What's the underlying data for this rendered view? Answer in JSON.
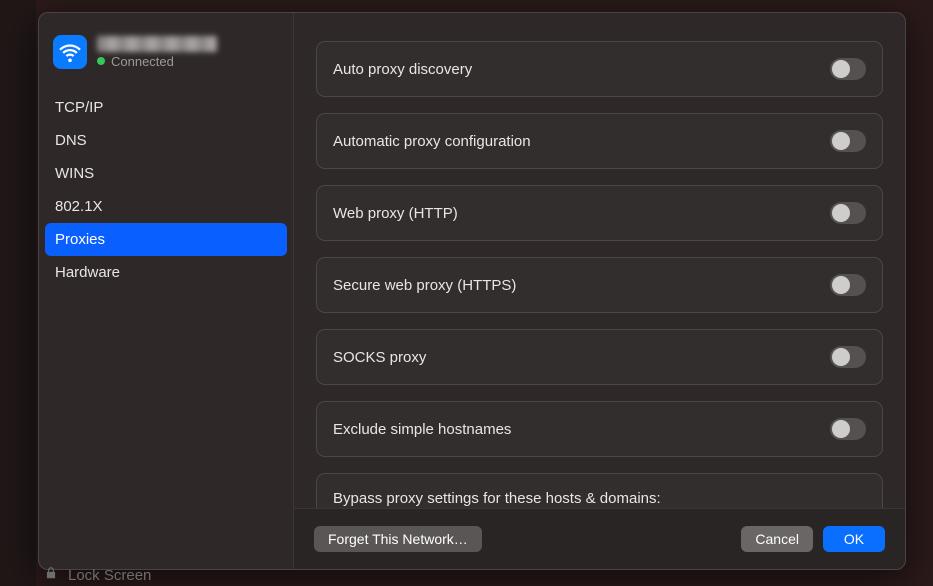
{
  "network": {
    "status_label": "Connected",
    "status_color": "#34c759"
  },
  "sidebar": {
    "items": [
      {
        "label": "TCP/IP",
        "selected": false
      },
      {
        "label": "DNS",
        "selected": false
      },
      {
        "label": "WINS",
        "selected": false
      },
      {
        "label": "802.1X",
        "selected": false
      },
      {
        "label": "Proxies",
        "selected": true
      },
      {
        "label": "Hardware",
        "selected": false
      }
    ]
  },
  "main": {
    "rows": [
      {
        "label": "Auto proxy discovery",
        "value": false
      },
      {
        "label": "Automatic proxy configuration",
        "value": false
      },
      {
        "label": "Web proxy (HTTP)",
        "value": false
      },
      {
        "label": "Secure web proxy (HTTPS)",
        "value": false
      },
      {
        "label": "SOCKS proxy",
        "value": false
      },
      {
        "label": "Exclude simple hostnames",
        "value": false
      }
    ],
    "bypass": {
      "label": "Bypass proxy settings for these hosts & domains:"
    }
  },
  "footer": {
    "forget_label": "Forget This Network…",
    "cancel_label": "Cancel",
    "ok_label": "OK"
  },
  "background": {
    "lock_label": "Lock Screen"
  }
}
